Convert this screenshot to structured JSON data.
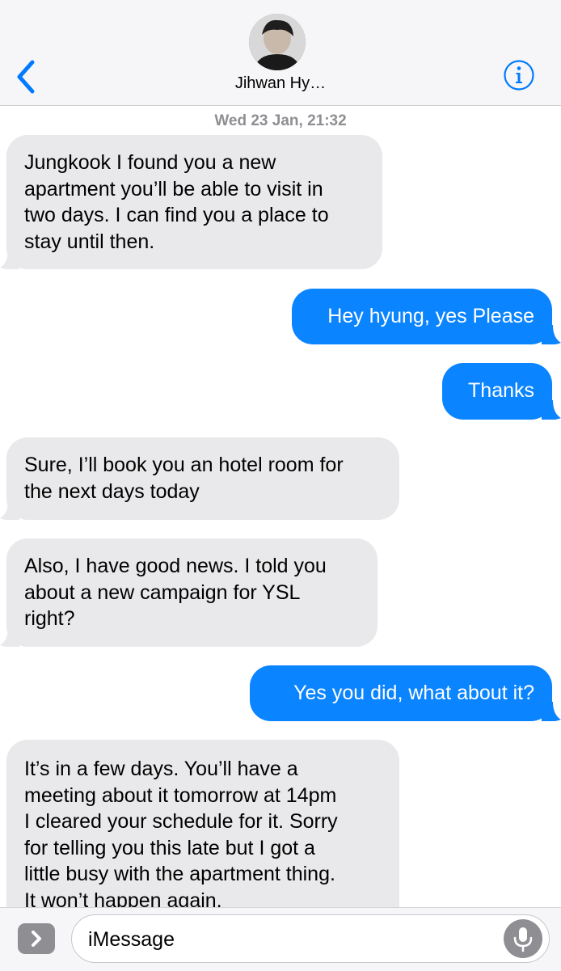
{
  "header": {
    "contact_name": "Jihwan Hy…"
  },
  "thread": {
    "timestamp": "Wed 23 Jan, 21:32",
    "messages": [
      {
        "direction": "incoming",
        "lines": [
          "Jungkook I found you a new",
          "apartment you’ll be able to visit in",
          "two days. I can find you a place to",
          "stay until then."
        ]
      },
      {
        "direction": "outgoing",
        "lines": [
          "Hey hyung, yes Please"
        ]
      },
      {
        "direction": "outgoing",
        "lines": [
          "Thanks"
        ]
      },
      {
        "direction": "incoming",
        "lines": [
          "Sure, I’ll book you an hotel room for",
          "the next days today"
        ]
      },
      {
        "direction": "incoming",
        "lines": [
          "Also, I have good news. I told you",
          "about a new campaign for YSL",
          "right?"
        ]
      },
      {
        "direction": "outgoing",
        "lines": [
          "Yes you did, what about it?"
        ]
      },
      {
        "direction": "incoming",
        "lines": [
          "It’s in a few days. You’ll have a",
          "meeting about it tomorrow at 14pm",
          "I cleared your schedule for it. Sorry",
          "for telling you this late but I got a",
          "little busy with the apartment thing.",
          "It won’t happen again."
        ]
      }
    ]
  },
  "composer": {
    "placeholder": "iMessage"
  },
  "colors": {
    "incoming_bubble": "#e9e9eb",
    "outgoing_bubble": "#0a84ff",
    "accent": "#007aff"
  },
  "icons": {
    "back": "chevron-left-icon",
    "info": "info-icon",
    "apps": "chevron-right-icon",
    "mic": "microphone-icon"
  }
}
